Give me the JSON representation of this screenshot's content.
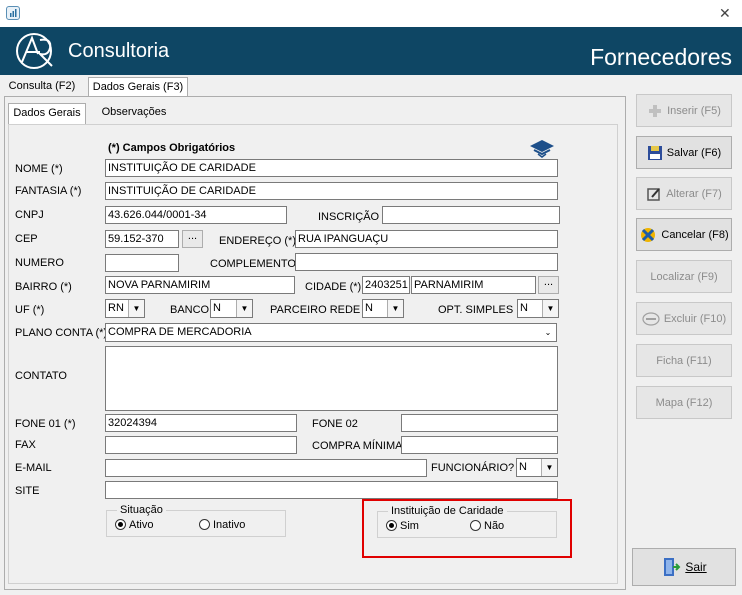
{
  "window": {
    "close_glyph": "✕"
  },
  "banner": {
    "brand": "Consultoria",
    "title": "Fornecedores"
  },
  "tabs_top": [
    {
      "label": "Consulta (F2)"
    },
    {
      "label": "Dados Gerais (F3)"
    }
  ],
  "tabs_sub": [
    {
      "label": "Dados Gerais"
    },
    {
      "label": "Observações"
    }
  ],
  "form": {
    "required_note": "(*) Campos Obrigatórios",
    "nome": {
      "label": "NOME (*)",
      "value": "INSTITUIÇÃO DE CARIDADE"
    },
    "fantasia": {
      "label": "FANTASIA (*)",
      "value": "INSTITUIÇÃO DE CARIDADE"
    },
    "cnpj": {
      "label": "CNPJ",
      "value": "43.626.044/0001-34"
    },
    "inscricao": {
      "label": "INSCRIÇÃO",
      "value": ""
    },
    "cep": {
      "label": "CEP",
      "value": "59.152-370"
    },
    "endereco": {
      "label": "ENDEREÇO (*)",
      "value": "RUA IPANGUAÇU"
    },
    "numero": {
      "label": "NUMERO",
      "value": ""
    },
    "complemento": {
      "label": "COMPLEMENTO",
      "value": ""
    },
    "bairro": {
      "label": "BAIRRO (*)",
      "value": "NOVA PARNAMIRIM"
    },
    "cidade": {
      "label": "CIDADE (*)",
      "code": "2403251",
      "value": "PARNAMIRIM"
    },
    "uf": {
      "label": "UF (*)",
      "value": "RN"
    },
    "banco": {
      "label": "BANCO",
      "value": "N"
    },
    "parceiro": {
      "label": "PARCEIRO REDE",
      "value": "N"
    },
    "opt_simples": {
      "label": "OPT. SIMPLES",
      "value": "N"
    },
    "plano_conta": {
      "label": "PLANO CONTA (*)",
      "value": "COMPRA DE MERCADORIA"
    },
    "contato": {
      "label": "CONTATO",
      "value": ""
    },
    "fone01": {
      "label": "FONE 01 (*)",
      "value": "32024394"
    },
    "fone02": {
      "label": "FONE 02",
      "value": ""
    },
    "fax": {
      "label": "FAX",
      "value": ""
    },
    "compra_minima": {
      "label": "COMPRA MÍNIMA",
      "value": ""
    },
    "email": {
      "label": "E-MAIL",
      "value": ""
    },
    "funcionario": {
      "label": "FUNCIONÁRIO?",
      "value": "N"
    },
    "site": {
      "label": "SITE",
      "value": ""
    },
    "ellipsis": "...",
    "situacao": {
      "title": "Situação",
      "opt1": "Ativo",
      "opt2": "Inativo"
    },
    "caridade": {
      "title": "Instituição de Caridade",
      "opt1": "Sim",
      "opt2": "Não"
    }
  },
  "actions": {
    "inserir": "Inserir (F5)",
    "salvar": "Salvar (F6)",
    "alterar": "Alterar (F7)",
    "cancelar": "Cancelar (F8)",
    "localizar": "Localizar (F9)",
    "excluir": "Excluir (F10)",
    "ficha": "Ficha (F11)",
    "mapa": "Mapa (F12)",
    "sair": "Sair"
  },
  "colors": {
    "banner": "#0e4664",
    "highlight": "#e00000"
  }
}
